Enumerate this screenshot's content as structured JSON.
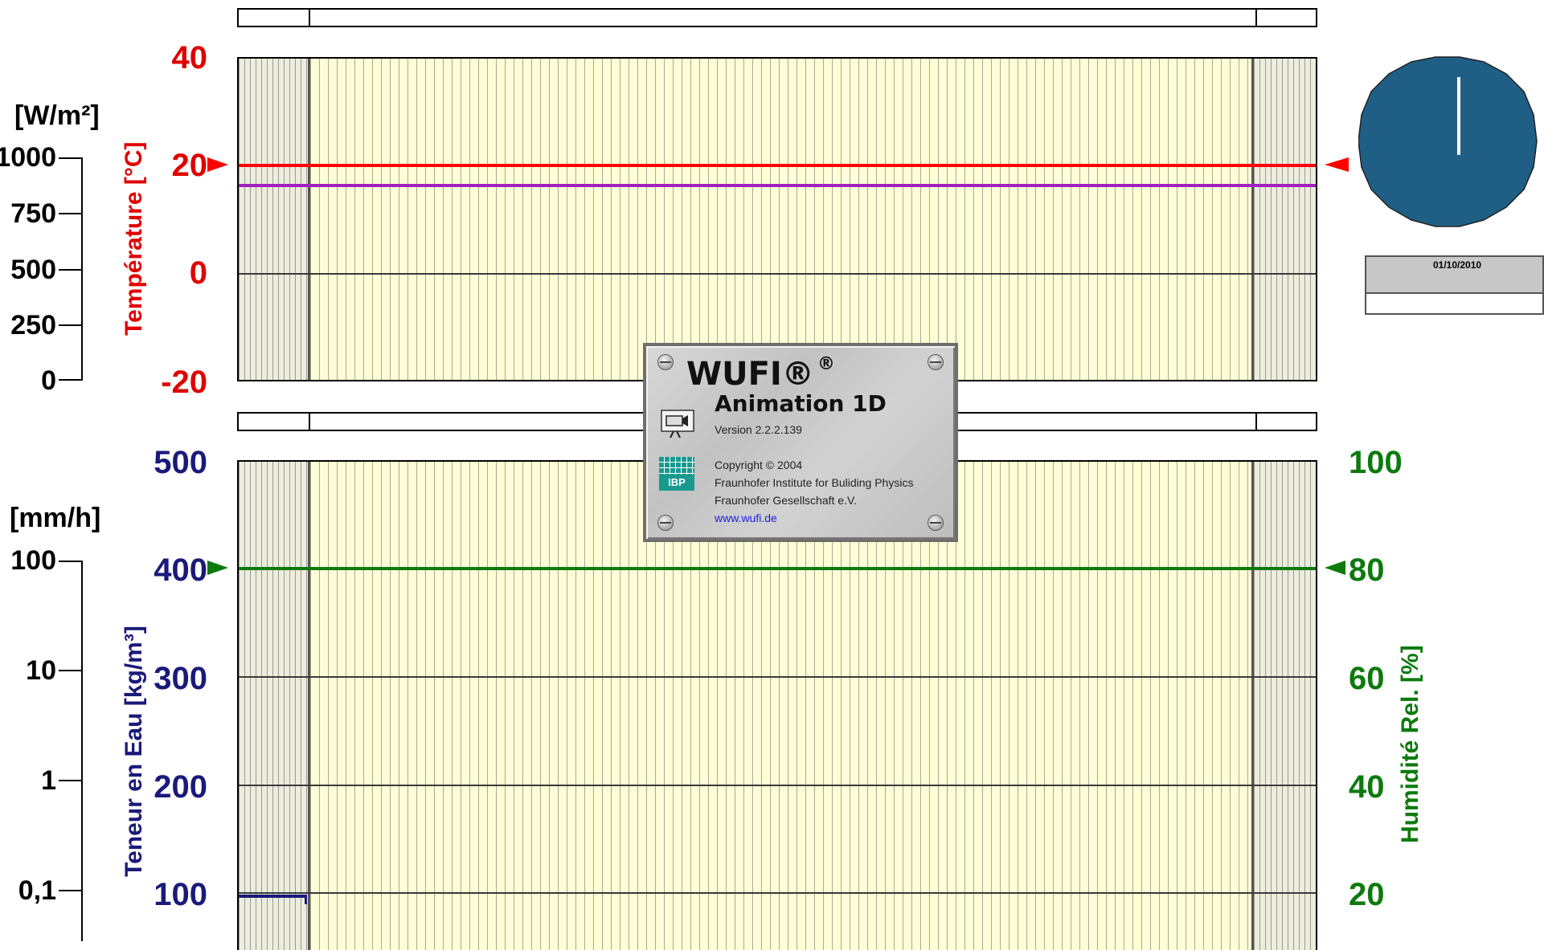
{
  "top_chart": {
    "left_unit": "[W/m²]",
    "left_scale_ticks": [
      "1000",
      "750",
      "500",
      "250",
      "0"
    ],
    "y_label": "Température [°C]",
    "y_ticks": [
      "40",
      "20",
      "0",
      "-20"
    ],
    "y_color": "#e00000"
  },
  "bottom_chart": {
    "left_unit": "[mm/h]",
    "left_scale_ticks": [
      "100",
      "10",
      "1",
      "0,1"
    ],
    "y_label": "Teneur en Eau [kg/m³]",
    "y_ticks": [
      "500",
      "400",
      "300",
      "200",
      "100"
    ],
    "y_color": "#1a1a7a",
    "y2_label": "Humidité Rel. [%]",
    "y2_ticks": [
      "100",
      "80",
      "60",
      "40",
      "20"
    ],
    "y2_color": "#0d7a0d"
  },
  "clock": {
    "date": "01/10/2010",
    "color": "#1f5f86"
  },
  "splash": {
    "title": "WUFI®",
    "reg_mark": "®",
    "product": "Animation 1D",
    "version": "Version 2.2.2.139",
    "copyright": "Copyright © 2004",
    "org1": "Fraunhofer Institute for Buliding Physics",
    "org2": "Fraunhofer Gesellschaft e.V.",
    "url": "www.wufi.de",
    "logo_text": "IBP",
    "camera_icon": "movie-camera-icon"
  },
  "chart_data": [
    {
      "type": "line",
      "title": "",
      "ylabel": "Température [°C]",
      "ylim": [
        -20,
        40
      ],
      "series": [
        {
          "values": [
            20,
            20
          ],
          "color": "#e00000"
        },
        {
          "values": [
            16.5,
            16.5
          ],
          "color": "#a020c0"
        }
      ],
      "markers": [
        20,
        20
      ]
    },
    {
      "type": "line",
      "title": "",
      "ylabel": "Teneur en Eau [kg/m³]",
      "ylim": [
        0,
        500
      ],
      "y2label": "Humidité Rel. [%]",
      "y2lim": [
        0,
        100
      ],
      "series": [
        {
          "values": [
            80,
            80
          ],
          "color": "#0d7a0d",
          "axis": "y2"
        },
        {
          "values": [
            97
          ],
          "color": "#1a1a7a",
          "axis": "y"
        }
      ],
      "markers": [
        400,
        80
      ]
    }
  ]
}
